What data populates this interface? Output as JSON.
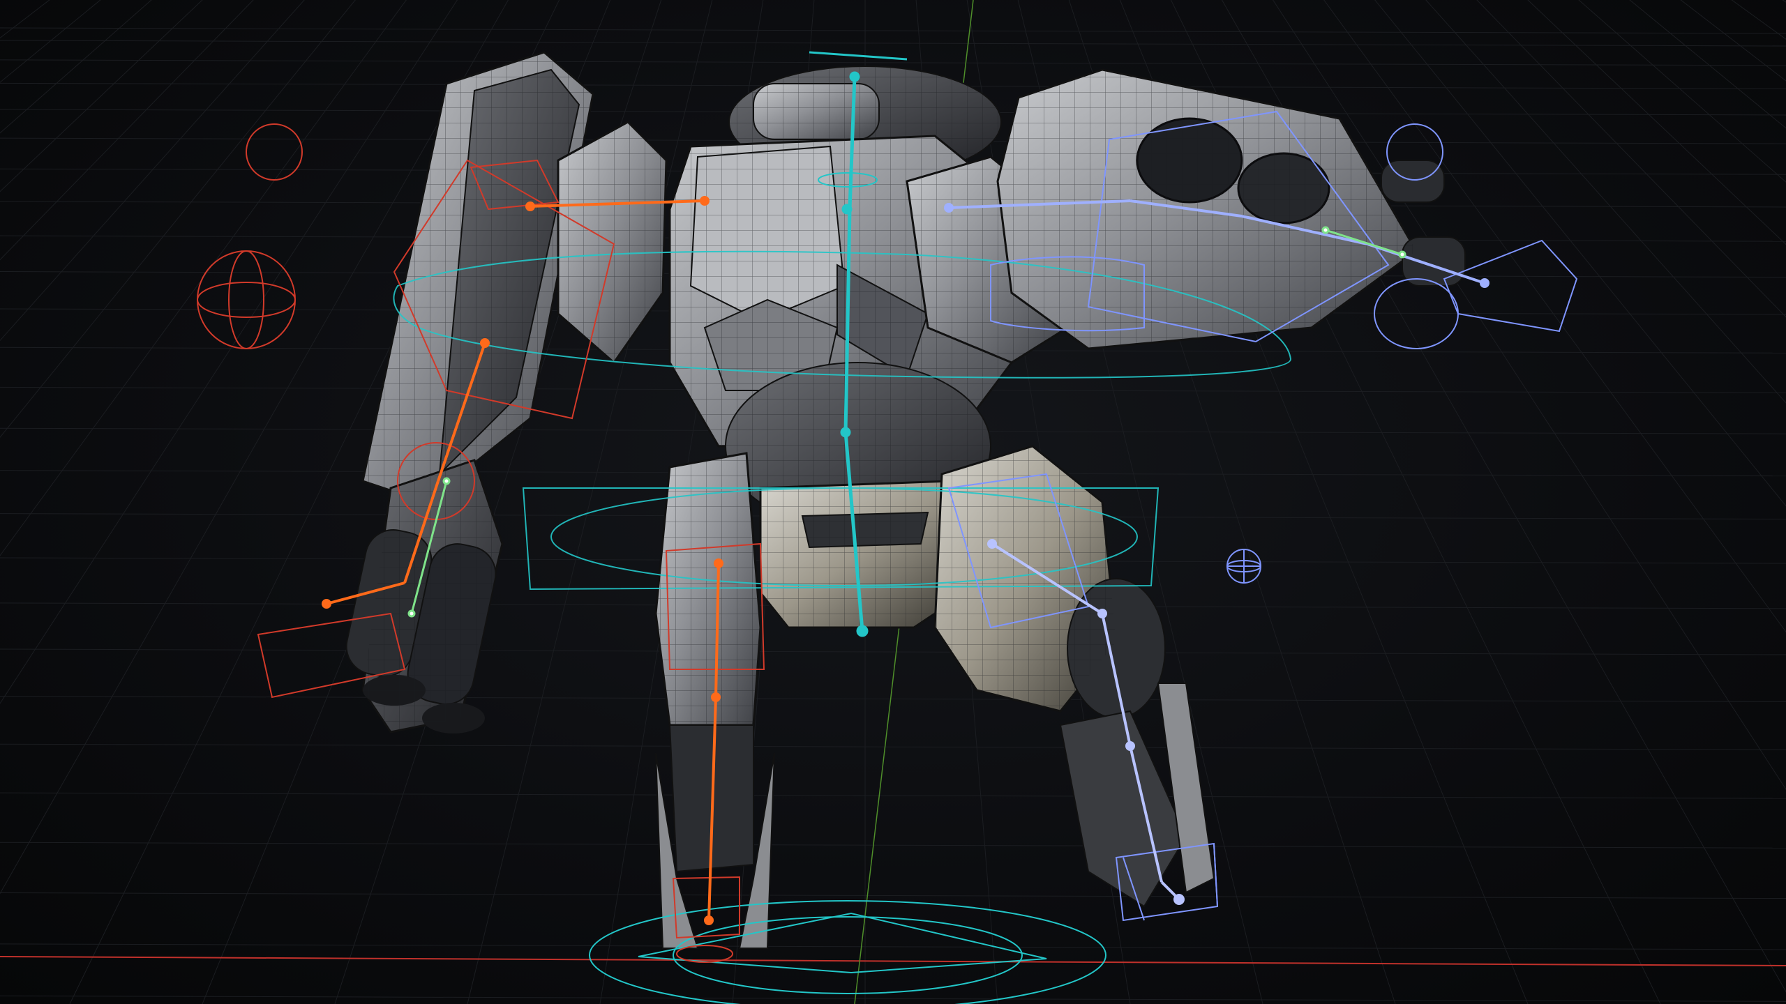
{
  "viewport": {
    "view": "3d-perspective",
    "background": "#0a0b0d",
    "grid_color": "#1b1d21",
    "x_axis_color": "#c0312b",
    "z_axis_color": "#4f8f2a"
  },
  "scene": {
    "subject": "mech-robot-rig",
    "shading": "solid-with-wireframe-overlay",
    "mesh_color": "#9a9ca0",
    "wire_color": "#2a2c30"
  },
  "rig": {
    "left_side_color": "#ff6a1a",
    "right_side_color": "#7f95ff",
    "center_color": "#23c6c8",
    "selected_bone_color": "#7fe38a"
  }
}
